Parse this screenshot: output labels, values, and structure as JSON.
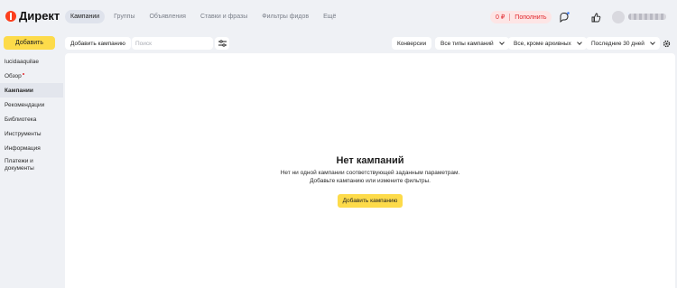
{
  "header": {
    "logo_text": "Директ",
    "tabs": [
      {
        "label": "Кампании",
        "active": true
      },
      {
        "label": "Группы"
      },
      {
        "label": "Объявления"
      },
      {
        "label": "Ставки и фразы"
      },
      {
        "label": "Фильтры фидов"
      },
      {
        "label": "Ещё"
      }
    ],
    "balance": "0 ₽",
    "topup_label": "Пополнить",
    "icons": [
      "chat-icon",
      "thumbs-up-icon",
      "avatar"
    ]
  },
  "toolbar": {
    "add_label": "Добавить",
    "add_campaign_label": "Добавить кампанию",
    "search_placeholder": "Поиск",
    "conversions_label": "Конверсии",
    "campaign_types": "Все типы кампаний",
    "status_filter": "Все, кроме архивных",
    "period": "Последние 30 дней"
  },
  "sidebar": {
    "items": [
      {
        "label": "lucidaaquilae"
      },
      {
        "label": "Обзор"
      },
      {
        "label": "Кампании",
        "active": true
      },
      {
        "label": "Рекомендации"
      },
      {
        "label": "Библиотека"
      },
      {
        "label": "Инструменты"
      },
      {
        "label": "Информация"
      },
      {
        "label": "Платежи и документы"
      }
    ]
  },
  "empty_state": {
    "title": "Нет кампаний",
    "line1": "Нет ни одной кампании соответствующей заданным параметрам.",
    "line2": "Добавьте кампанию или измените фильтры.",
    "button_label": "Добавить кампанию"
  },
  "colors": {
    "accent_yellow": "#fddb4a",
    "background": "#eff1f5",
    "alert_red": "#e0262c"
  }
}
